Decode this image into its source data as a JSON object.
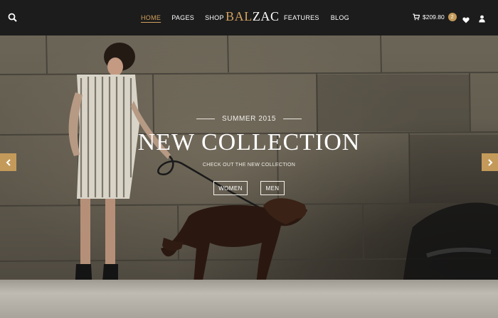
{
  "header": {
    "nav_left": [
      "HOME",
      "PAGES",
      "SHOP"
    ],
    "logo_part1": "BAL",
    "logo_part2": "ZAC",
    "nav_right": [
      "FEATURES",
      "BLOG"
    ],
    "cart_amount": "$209.80",
    "cart_count": "2",
    "icons": [
      "search-icon",
      "cart-icon",
      "heart-icon",
      "user-icon"
    ]
  },
  "hero": {
    "eyebrow": "SUMMER 2015",
    "headline": "NEW COLLECTION",
    "subtitle": "CHECK OUT THE NEW COLLECTION",
    "button_women": "WOMEN",
    "button_men": "MEN"
  },
  "colors": {
    "accent": "#c49a5a",
    "header_bg": "#1c1c1c",
    "text_light": "#ffffff"
  }
}
